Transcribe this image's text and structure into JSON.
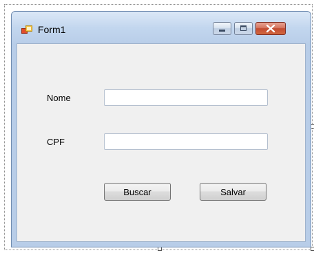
{
  "window": {
    "title": "Form1",
    "icons": {
      "app": "form-app-icon",
      "minimize": "minimize-icon",
      "maximize": "maximize-icon",
      "close": "close-icon"
    }
  },
  "form": {
    "nome_label": "Nome",
    "nome_value": "",
    "cpf_label": "CPF",
    "cpf_value": "",
    "buscar_label": "Buscar",
    "salvar_label": "Salvar"
  },
  "colors": {
    "client_background": "#f0f0f0",
    "titlebar_gradient_top": "#dbe8f7",
    "close_button": "#c24a31"
  }
}
